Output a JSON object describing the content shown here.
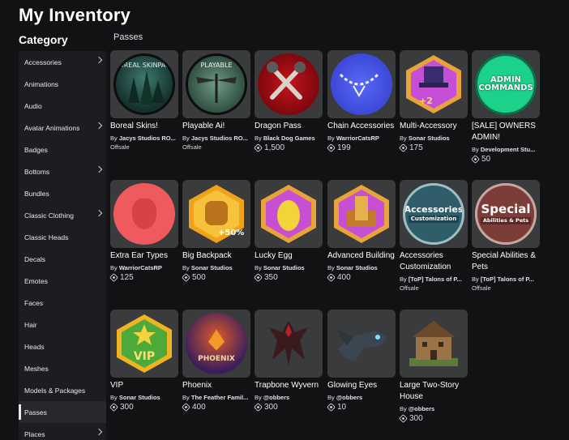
{
  "page": {
    "title": "My Inventory"
  },
  "sidebar": {
    "heading": "Category",
    "items": [
      {
        "label": "Accessories",
        "chevron": true
      },
      {
        "label": "Animations",
        "chevron": false
      },
      {
        "label": "Audio",
        "chevron": false
      },
      {
        "label": "Avatar Animations",
        "chevron": true
      },
      {
        "label": "Badges",
        "chevron": false
      },
      {
        "label": "Bottoms",
        "chevron": true
      },
      {
        "label": "Bundles",
        "chevron": false
      },
      {
        "label": "Classic Clothing",
        "chevron": true
      },
      {
        "label": "Classic Heads",
        "chevron": false
      },
      {
        "label": "Decals",
        "chevron": false
      },
      {
        "label": "Emotes",
        "chevron": false
      },
      {
        "label": "Faces",
        "chevron": false
      },
      {
        "label": "Hair",
        "chevron": false
      },
      {
        "label": "Heads",
        "chevron": false
      },
      {
        "label": "Meshes",
        "chevron": false
      },
      {
        "label": "Models & Packages",
        "chevron": false
      },
      {
        "label": "Passes",
        "chevron": false,
        "active": true
      },
      {
        "label": "Places",
        "chevron": true
      }
    ]
  },
  "main": {
    "section_label": "Passes",
    "items": [
      {
        "name": "Boreal Skins!",
        "by": "By",
        "creator": "Jacys Studios RO...",
        "price": null,
        "offsale": "Offsale",
        "art_text": "BOREAL SKINPACK"
      },
      {
        "name": "Playable Ai!",
        "by": "By",
        "creator": "Jacys Studios RO...",
        "price": null,
        "offsale": "Offsale",
        "art_text": "PLAYABLE"
      },
      {
        "name": "Dragon Pass",
        "by": "By",
        "creator": "Black Dog Games",
        "price": "1,500",
        "offsale": null
      },
      {
        "name": "Chain Accessories",
        "by": "By",
        "creator": "WarriorCatsRP",
        "price": "199",
        "offsale": null
      },
      {
        "name": "Multi-Accessory",
        "by": "By",
        "creator": "Sonar Studios",
        "price": "175",
        "offsale": null,
        "art_text": "+2"
      },
      {
        "name": "[SALE] OWNERS ADMIN!",
        "by": "By",
        "creator": "Development Stu...",
        "price": "50",
        "offsale": null,
        "art_text": "ADMIN COMMANDS"
      },
      {
        "name": "Extra Ear Types",
        "by": "By",
        "creator": "WarriorCatsRP",
        "price": "125",
        "offsale": null
      },
      {
        "name": "Big Backpack",
        "by": "By",
        "creator": "Sonar Studios",
        "price": "500",
        "offsale": null,
        "art_text": "+50%"
      },
      {
        "name": "Lucky Egg",
        "by": "By",
        "creator": "Sonar Studios",
        "price": "350",
        "offsale": null
      },
      {
        "name": "Advanced Building",
        "by": "By",
        "creator": "Sonar Studios",
        "price": "400",
        "offsale": null
      },
      {
        "name": "Accessories Customization",
        "by": "By",
        "creator": "[ToP] Talons of P...",
        "price": null,
        "offsale": "Offsale",
        "art_text": "Accessories",
        "art_sub": "Customization"
      },
      {
        "name": "Special Abilities & Pets",
        "by": "By",
        "creator": "[ToP] Talons of P...",
        "price": null,
        "offsale": "Offsale",
        "art_text": "Special",
        "art_sub": "Abilities & Pets"
      },
      {
        "name": "VIP",
        "by": "By",
        "creator": "Sonar Studios",
        "price": "300",
        "offsale": null,
        "art_text": "VIP"
      },
      {
        "name": "Phoenix",
        "by": "By",
        "creator": "The Feather Famil...",
        "price": "400",
        "offsale": null,
        "art_text": "PHOENIX"
      },
      {
        "name": "Trapbone Wyvern",
        "by": "By",
        "creator": "@obbers",
        "price": "300",
        "offsale": null
      },
      {
        "name": "Glowing Eyes",
        "by": "By",
        "creator": "@obbers",
        "price": "10",
        "offsale": null
      },
      {
        "name": "Large Two-Story House",
        "by": "By",
        "creator": "@obbers",
        "price": "300",
        "offsale": null
      }
    ]
  },
  "colors": {
    "background": "#111214",
    "sidebar": "#1b1d21",
    "thumb_bg": "#393b3d"
  }
}
